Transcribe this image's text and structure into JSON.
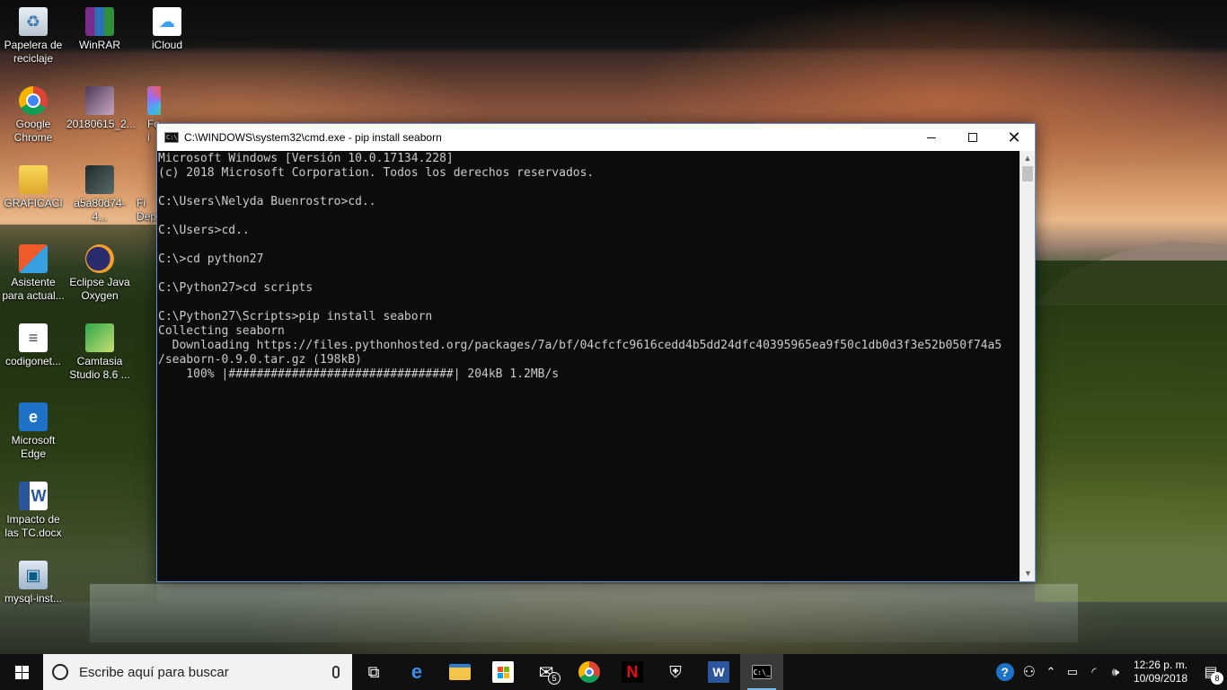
{
  "desktop": {
    "icons": [
      {
        "label": "Papelera de reciclaje",
        "icon": "recycle-bin-icon"
      },
      {
        "label": "WinRAR",
        "icon": "winrar-icon"
      },
      {
        "label": "iCloud",
        "icon": "icloud-icon"
      },
      {
        "label": "Google Chrome",
        "icon": "chrome-icon"
      },
      {
        "label": "20180615_2...",
        "icon": "photo-file-icon"
      },
      {
        "label": "Fo i",
        "icon": "photos-icon"
      },
      {
        "label": "GRAFICACI",
        "icon": "document-icon"
      },
      {
        "label": "a5a80d74-4...",
        "icon": "image-file-icon"
      },
      {
        "label": "Fi Dep",
        "icon": "folder-icon"
      },
      {
        "label": "Asistente para actual...",
        "icon": "windows-update-assistant-icon"
      },
      {
        "label": "Eclipse Java Oxygen",
        "icon": "eclipse-icon"
      },
      {
        "label": "codigonet...",
        "icon": "text-file-icon"
      },
      {
        "label": "Camtasia Studio 8.6 ...",
        "icon": "camtasia-icon"
      },
      {
        "label": "Microsoft Edge",
        "icon": "edge-icon"
      },
      {
        "label": "Impacto de las TC.docx",
        "icon": "word-document-icon"
      },
      {
        "label": "mysql-inst...",
        "icon": "mysql-installer-icon"
      }
    ]
  },
  "cmd": {
    "title": "C:\\WINDOWS\\system32\\cmd.exe - pip  install seaborn",
    "lines": [
      "Microsoft Windows [Versión 10.0.17134.228]",
      "(c) 2018 Microsoft Corporation. Todos los derechos reservados.",
      "",
      "C:\\Users\\Nelyda Buenrostro>cd..",
      "",
      "C:\\Users>cd..",
      "",
      "C:\\>cd python27",
      "",
      "C:\\Python27>cd scripts",
      "",
      "C:\\Python27\\Scripts>pip install seaborn",
      "Collecting seaborn",
      "  Downloading https://files.pythonhosted.org/packages/7a/bf/04cfcfc9616cedd4b5dd24dfc40395965ea9f50c1db0d3f3e52b050f74a5",
      "/seaborn-0.9.0.tar.gz (198kB)",
      "    100% |################################| 204kB 1.2MB/s"
    ],
    "buttons": {
      "minimize": "—",
      "maximize": "☐",
      "close": "✕"
    }
  },
  "taskbar": {
    "search_placeholder": "Escribe aquí para buscar",
    "apps": [
      {
        "name": "task-view",
        "glyph": "⧉"
      },
      {
        "name": "edge",
        "glyph": "e"
      },
      {
        "name": "file-explorer",
        "glyph": "▬"
      },
      {
        "name": "store",
        "glyph": "▦"
      },
      {
        "name": "mail",
        "glyph": "✉",
        "badge": "5"
      },
      {
        "name": "chrome",
        "glyph": "●"
      },
      {
        "name": "netflix",
        "glyph": "N"
      },
      {
        "name": "security",
        "glyph": "⛨"
      },
      {
        "name": "word",
        "glyph": "W"
      },
      {
        "name": "cmd",
        "glyph": "C:\\_"
      }
    ],
    "tray": {
      "help": "?",
      "people": "⚇",
      "chevron": "⌃",
      "battery": "▭",
      "wifi": "◜",
      "volume": "🕪",
      "time": "12:26 p. m.",
      "date": "10/09/2018",
      "notifications": "8"
    }
  },
  "colors": {
    "console_bg": "#0c0c0c",
    "console_fg": "#cccccc",
    "taskbar_bg": "#101010",
    "accent": "#76b9ed"
  }
}
